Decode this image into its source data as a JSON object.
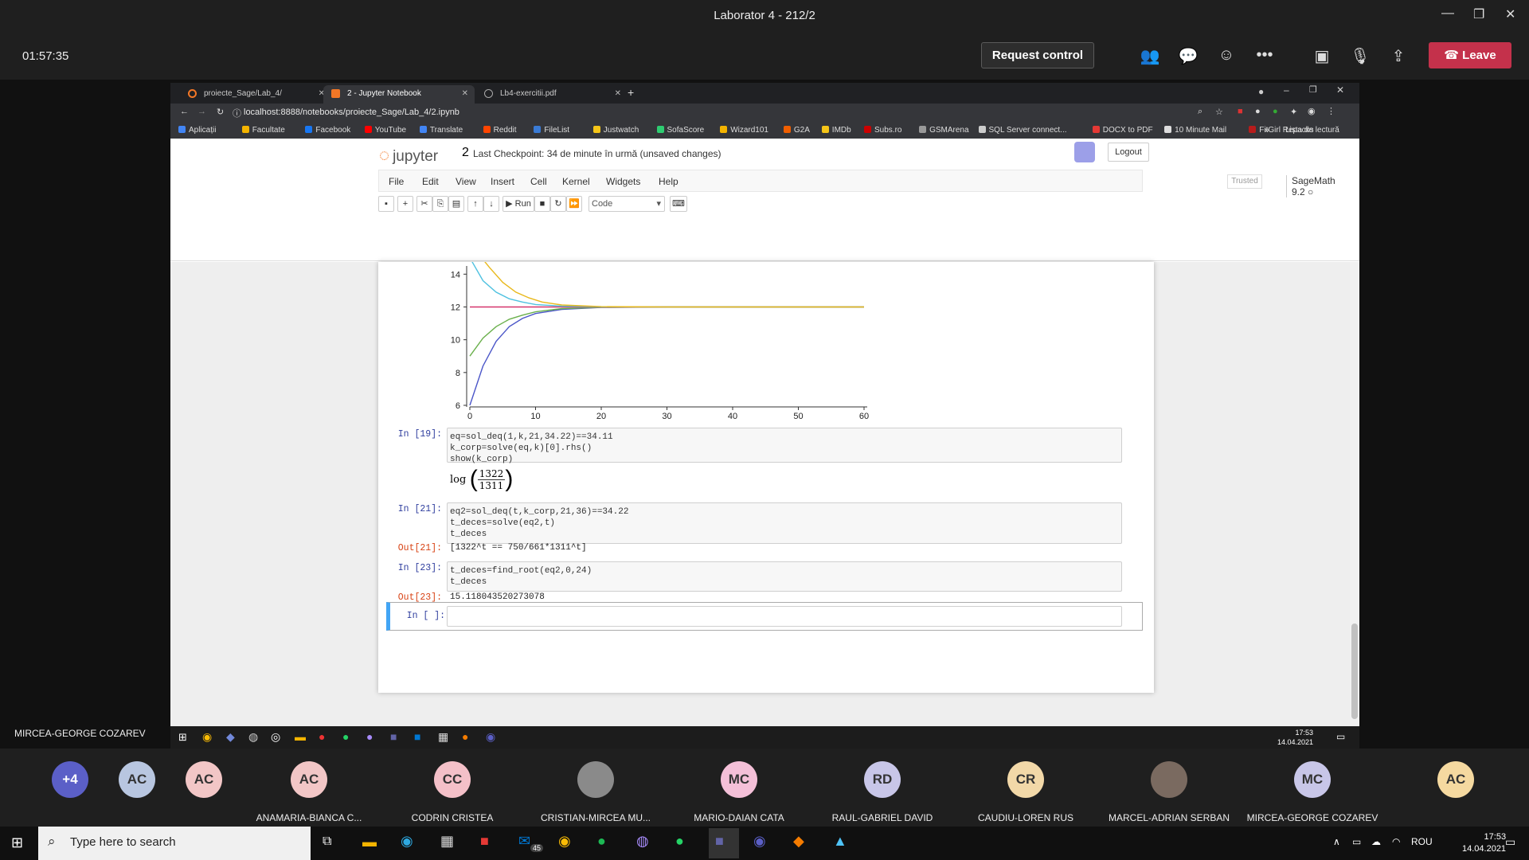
{
  "window": {
    "title": "Laborator 4 - 212/2"
  },
  "meeting": {
    "timer": "01:57:35",
    "request_control": "Request control",
    "leave": "Leave"
  },
  "browser": {
    "tabs": [
      {
        "label": "proiecte_Sage/Lab_4/",
        "color": "#f37726"
      },
      {
        "label": "2 - Jupyter Notebook",
        "color": "#f37726"
      },
      {
        "label": "Lb4-exercitii.pdf",
        "color": "#888888"
      }
    ],
    "url": "localhost:8888/notebooks/proiecte_Sage/Lab_4/2.ipynb",
    "bookmarks": [
      {
        "label": "Aplicații",
        "color": "#4285f4"
      },
      {
        "label": "Facultate",
        "color": "#f4b400"
      },
      {
        "label": "Facebook",
        "color": "#1877f2"
      },
      {
        "label": "YouTube",
        "color": "#ff0000"
      },
      {
        "label": "Translate",
        "color": "#4285f4"
      },
      {
        "label": "Reddit",
        "color": "#ff4500"
      },
      {
        "label": "FileList",
        "color": "#3a7bd5"
      },
      {
        "label": "Justwatch",
        "color": "#f5c518"
      },
      {
        "label": "SofaScore",
        "color": "#2ecc71"
      },
      {
        "label": "Wizard101",
        "color": "#f4b400"
      },
      {
        "label": "G2A",
        "color": "#f05f00"
      },
      {
        "label": "IMDb",
        "color": "#f5c518"
      },
      {
        "label": "Subs.ro",
        "color": "#cc0000"
      },
      {
        "label": "GSMArena",
        "color": "#999999"
      },
      {
        "label": "SQL Server connect...",
        "color": "#cccccc"
      },
      {
        "label": "DOCX to PDF",
        "color": "#e53935"
      },
      {
        "label": "10 Minute Mail",
        "color": "#dddddd"
      },
      {
        "label": "FitGirl Repacks",
        "color": "#b71c1c"
      }
    ],
    "reading_list": "Lista de lectură"
  },
  "jupyter": {
    "logo": "jupyter",
    "notebook_name": "2",
    "checkpoint": "Last Checkpoint: 34 de minute în urmă  (unsaved changes)",
    "logout": "Logout",
    "menu": [
      "File",
      "Edit",
      "View",
      "Insert",
      "Cell",
      "Kernel",
      "Widgets",
      "Help"
    ],
    "trusted": "Trusted",
    "kernel": "SageMath 9.2",
    "run_label": "Run",
    "cell_type": "Code"
  },
  "chart_data": {
    "type": "line",
    "x_ticks": [
      0,
      10,
      20,
      30,
      40,
      50,
      60
    ],
    "y_ticks": [
      6,
      8,
      10,
      12,
      14
    ],
    "xlim": [
      0,
      60
    ],
    "ylim": [
      6,
      14.5
    ],
    "series": [
      {
        "color": "#4a55c8",
        "values": [
          [
            0,
            6
          ],
          [
            2,
            8.4
          ],
          [
            4,
            9.9
          ],
          [
            6,
            10.8
          ],
          [
            8,
            11.3
          ],
          [
            10,
            11.6
          ],
          [
            14,
            11.85
          ],
          [
            20,
            11.97
          ],
          [
            30,
            12
          ],
          [
            60,
            12
          ]
        ]
      },
      {
        "color": "#6ab04c",
        "values": [
          [
            0,
            9
          ],
          [
            2,
            10.1
          ],
          [
            4,
            10.8
          ],
          [
            6,
            11.25
          ],
          [
            8,
            11.5
          ],
          [
            10,
            11.7
          ],
          [
            14,
            11.9
          ],
          [
            20,
            11.98
          ],
          [
            30,
            12
          ],
          [
            60,
            12
          ]
        ]
      },
      {
        "color": "#d6336c",
        "values": [
          [
            0,
            12
          ],
          [
            60,
            12
          ]
        ]
      },
      {
        "color": "#4fc1e0",
        "values": [
          [
            0,
            15
          ],
          [
            2,
            13.6
          ],
          [
            4,
            12.9
          ],
          [
            6,
            12.5
          ],
          [
            8,
            12.3
          ],
          [
            10,
            12.15
          ],
          [
            14,
            12.05
          ],
          [
            20,
            12.01
          ],
          [
            30,
            12
          ],
          [
            60,
            12
          ]
        ]
      },
      {
        "color": "#e8b81a",
        "values": [
          [
            1.8,
            15
          ],
          [
            3,
            14.4
          ],
          [
            5,
            13.5
          ],
          [
            7,
            12.9
          ],
          [
            9,
            12.55
          ],
          [
            11,
            12.3
          ],
          [
            14,
            12.12
          ],
          [
            20,
            12.02
          ],
          [
            30,
            12
          ],
          [
            60,
            12
          ]
        ]
      }
    ]
  },
  "cells": [
    {
      "prompt": "In [19]:",
      "code": "eq=sol_deq(1,k,21,34.22)==34.11\nk_corp=solve(eq,k)[0].rhs()\nshow(k_corp)",
      "math": {
        "fn": "log",
        "num": "1322",
        "den": "1311"
      }
    },
    {
      "prompt": "In [21]:",
      "code": "eq2=sol_deq(t,k_corp,21,36)==34.22\nt_deces=solve(eq2,t)\nt_deces",
      "out_prompt": "Out[21]:",
      "out": "[1322^t == 750/661*1311^t]"
    },
    {
      "prompt": "In [23]:",
      "code": "t_deces=find_root(eq2,0,24)\nt_deces",
      "out_prompt": "Out[23]:",
      "out": "15.1180435202730​78"
    },
    {
      "prompt": "In [ ]:",
      "code": ""
    }
  ],
  "remote": {
    "user": "MIRCEA-GEORGE COZAREV",
    "clock_time": "17:53",
    "clock_date": "14.04.2021"
  },
  "participants": [
    {
      "initials": "+4",
      "name": "",
      "color": "#5b5fc7"
    },
    {
      "initials": "AC",
      "name": "",
      "color": "#b8c6e0"
    },
    {
      "initials": "AC",
      "name": "",
      "color": "#f2c6c6"
    },
    {
      "initials": "AC",
      "name": "ANAMARIA-BIANCA C...",
      "color": "#f2c6c6"
    },
    {
      "initials": "CC",
      "name": "CODRIN CRISTEA",
      "color": "#f4c0c8"
    },
    {
      "initials": "",
      "name": "CRISTIAN-MIRCEA MU...",
      "color": "#8a8a8a"
    },
    {
      "initials": "MC",
      "name": "MARIO-DAIAN CATA",
      "color": "#f4c0d8"
    },
    {
      "initials": "RD",
      "name": "RAUL-GABRIEL DAVID",
      "color": "#c8c6e8"
    },
    {
      "initials": "CR",
      "name": "CAUDIU-LOREN RUS",
      "color": "#f2d8a8"
    },
    {
      "initials": "",
      "name": "MARCEL-ADRIAN SERBAN",
      "color": "#7a6a60"
    },
    {
      "initials": "MC",
      "name": "MIRCEA-GEORGE COZAREV",
      "color": "#c8c6e8"
    },
    {
      "initials": "AC",
      "name": "",
      "color": "#f5d9a0"
    }
  ],
  "taskbar": {
    "search_placeholder": "Type here to search",
    "lang": "ROU",
    "time": "17:53",
    "date": "14.04.2021",
    "mail_badge": "45"
  }
}
